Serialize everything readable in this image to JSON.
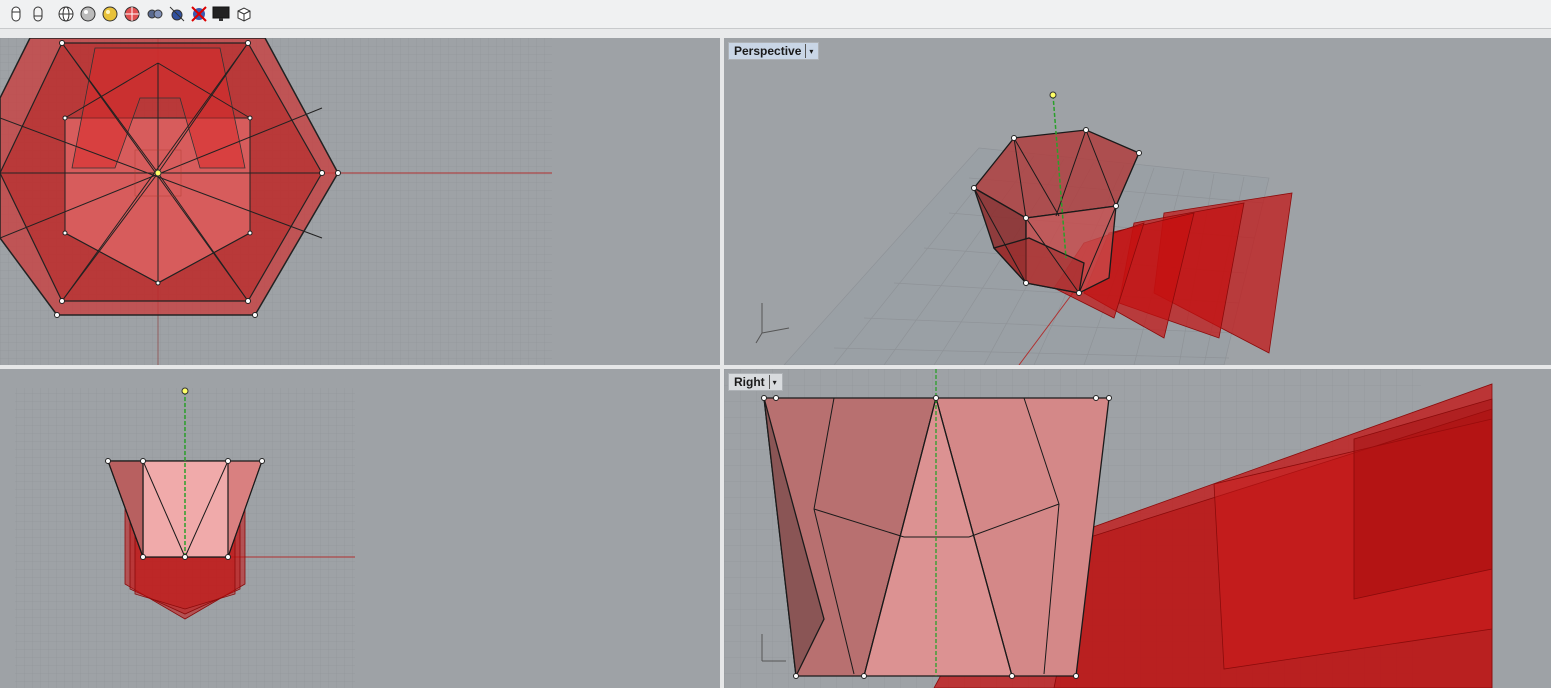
{
  "toolbar": {
    "buttons": [
      {
        "name": "toolbar-cylinder-a-icon"
      },
      {
        "name": "toolbar-cylinder-b-icon"
      },
      {
        "name": "wireframe-sphere-icon"
      },
      {
        "name": "shaded-sphere-icon"
      },
      {
        "name": "rendered-sphere-icon"
      },
      {
        "name": "target-sphere-icon"
      },
      {
        "name": "xray-icon"
      },
      {
        "name": "capture-icon"
      },
      {
        "name": "no-display-icon"
      },
      {
        "name": "monitor-icon"
      },
      {
        "name": "cube-icon"
      }
    ]
  },
  "viewports": {
    "perspective": {
      "label": "Perspective",
      "active": true
    },
    "right": {
      "label": "Right"
    }
  },
  "colors": {
    "viewport_bg": "#9ea2a6",
    "grid": "#8f9398",
    "mesh_red": "#c41a1a",
    "mesh_pink": "#d98a8a",
    "axis_x": "#b03030",
    "axis_z": "#2aa02a"
  }
}
